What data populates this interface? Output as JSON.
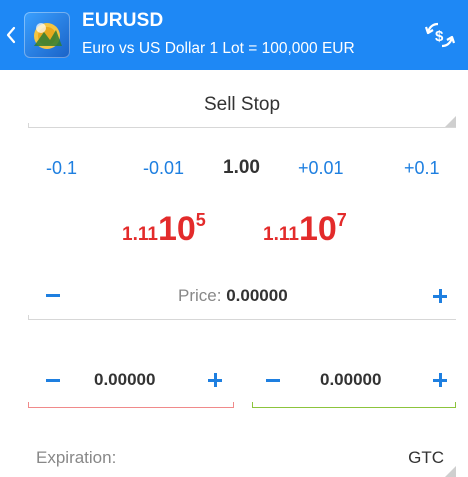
{
  "header": {
    "symbol": "EURUSD",
    "description": "Euro vs US Dollar 1 Lot = 100,000 EUR",
    "icons": [
      "back-chevron-icon",
      "app-logo-icon",
      "currency-exchange-icon"
    ]
  },
  "order_type": {
    "label": "Sell Stop"
  },
  "volume": {
    "minus_large": "-0.1",
    "minus_small": "-0.01",
    "value": "1.00",
    "plus_small": "+0.01",
    "plus_large": "+0.1"
  },
  "quotes": {
    "bid": {
      "prefix": "1.11",
      "big": "10",
      "sup": "5"
    },
    "ask": {
      "prefix": "1.11",
      "big": "10",
      "sup": "7"
    }
  },
  "price": {
    "label": "Price:",
    "value": "0.00000"
  },
  "stop_loss": {
    "value": "0.00000"
  },
  "take_profit": {
    "value": "0.00000"
  },
  "expiration": {
    "label": "Expiration:",
    "value": "GTC"
  },
  "colors": {
    "header": "#1e88f5",
    "accent": "#1e7fe0",
    "quote": "#e32b2b",
    "stop_loss_line": "#f08a8a",
    "take_profit_line": "#8cc43c"
  }
}
